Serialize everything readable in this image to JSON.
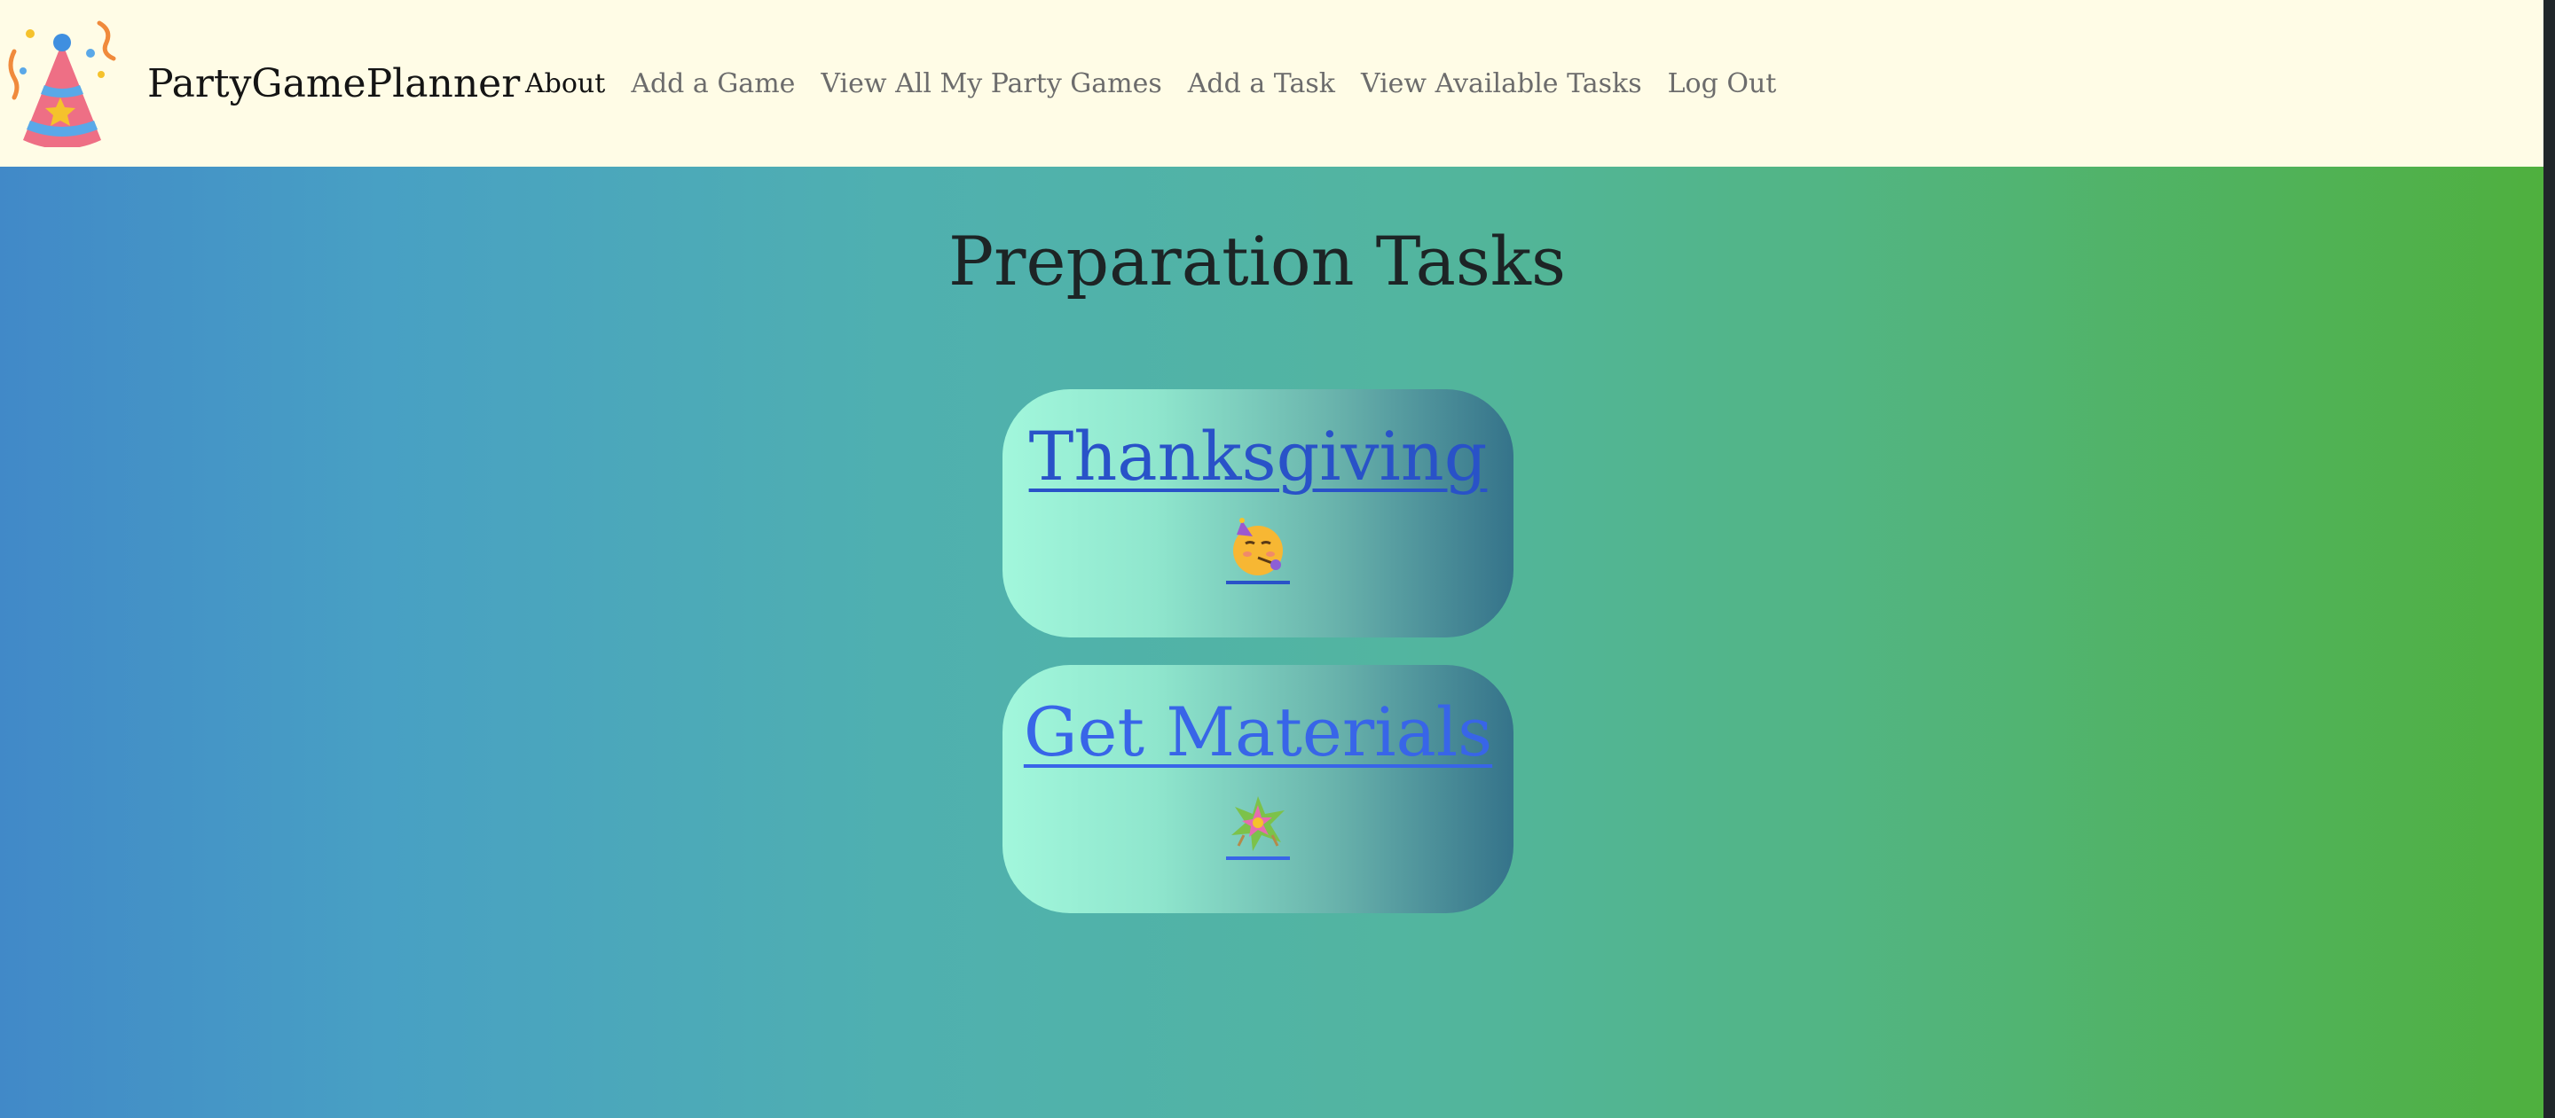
{
  "navbar": {
    "brand": "PartyGamePlanner",
    "logo_icon": "party-hat-icon",
    "links": [
      {
        "label": "About",
        "active": true
      },
      {
        "label": "Add a Game",
        "active": false
      },
      {
        "label": "View All My Party Games",
        "active": false
      },
      {
        "label": "Add a Task",
        "active": false
      },
      {
        "label": "View Available Tasks",
        "active": false
      },
      {
        "label": "Log Out",
        "active": false
      }
    ]
  },
  "main": {
    "title": "Preparation Tasks",
    "tasks": [
      {
        "name": "Thanksgiving",
        "icon": "partying-face-icon"
      },
      {
        "name": "Get Materials",
        "icon": "pinata-icon"
      }
    ]
  },
  "colors": {
    "navbar_bg": "#fffce6",
    "gradient_start": "#4189c8",
    "gradient_end": "#4fb03e",
    "task_link_visited": "#2952c8",
    "task_link": "#3865e8"
  }
}
